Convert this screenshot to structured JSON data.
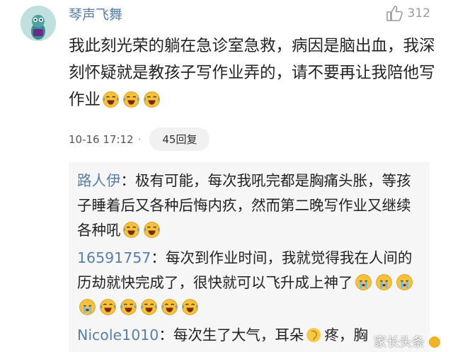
{
  "comment": {
    "author": "琴声飞舞",
    "likes": "312",
    "text": "我此刻光荣的躺在急诊室急救，病因是脑出血，我深刻怀疑就是教孩子写作业弄的，请不要再让我陪他写作业",
    "time": "10-16 17:12",
    "dot": "·",
    "reply_count": "45回复",
    "emoji_count": 3
  },
  "replies": [
    {
      "author": "路人伊",
      "sep": "：",
      "text": "极有可能，每次我吼完都是胸痛头胀，等孩子睡着后又各种后悔内疚，然而第二晚写作业又继续各种吼",
      "emojis": [
        "laugh-cry-emoji",
        "laugh-cry-emoji"
      ]
    },
    {
      "author": "16591757",
      "sep": "：",
      "text": "每次到作业时间，我就觉得我在人间的历劫就快完成了，很快就可以飞升成上神了",
      "emojis": [
        "cry-emoji",
        "cry-emoji",
        "cry-emoji",
        "cry-emoji",
        "laugh-cry-emoji",
        "laugh-cry-emoji",
        "laugh-cry-emoji",
        "laugh-cry-emoji",
        "laugh-cry-emoji"
      ]
    },
    {
      "author": "Nicole1010",
      "sep": "：",
      "text": "每次生了大气，耳朵",
      "text_after": "疼，胸",
      "emojis": []
    }
  ],
  "watermark": "家长头条"
}
